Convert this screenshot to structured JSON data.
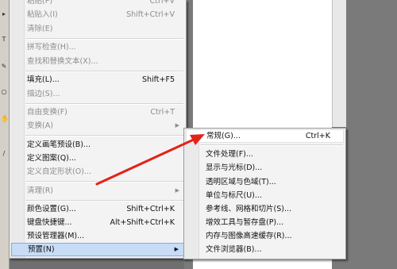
{
  "edit_menu": {
    "items": [
      {
        "label": "粘贴(P)",
        "shortcut": "Ctrl+V",
        "disabled": true
      },
      {
        "label": "粘贴入(I)",
        "shortcut": "Shift+Ctrl+V",
        "disabled": true
      },
      {
        "label": "清除(E)",
        "shortcut": "",
        "disabled": true
      },
      {
        "label": "拼写检查(H)...",
        "shortcut": "",
        "disabled": true
      },
      {
        "label": "查找和替换文本(X)...",
        "shortcut": "",
        "disabled": true
      },
      {
        "label": "填充(L)...",
        "shortcut": "Shift+F5",
        "disabled": false
      },
      {
        "label": "描边(S)...",
        "shortcut": "",
        "disabled": true
      },
      {
        "label": "自由变换(F)",
        "shortcut": "Ctrl+T",
        "disabled": true
      },
      {
        "label": "变换(A)",
        "shortcut": "",
        "disabled": true
      },
      {
        "label": "定义画笔预设(B)...",
        "shortcut": "",
        "disabled": false
      },
      {
        "label": "定义图案(Q)...",
        "shortcut": "",
        "disabled": false
      },
      {
        "label": "定义自定形状(O)...",
        "shortcut": "",
        "disabled": true
      },
      {
        "label": "清理(R)",
        "shortcut": "",
        "disabled": true
      },
      {
        "label": "颜色设置(G)...",
        "shortcut": "Shift+Ctrl+K",
        "disabled": false
      },
      {
        "label": "键盘快捷键...",
        "shortcut": "Alt+Shift+Ctrl+K",
        "disabled": false
      },
      {
        "label": "预设管理器(M)...",
        "shortcut": "",
        "disabled": false
      },
      {
        "label": "预置(N)",
        "shortcut": "",
        "disabled": false
      }
    ]
  },
  "preferences_submenu": {
    "items": [
      {
        "label": "常规(G)...",
        "shortcut": "Ctrl+K"
      },
      {
        "label": "文件处理(F)...",
        "shortcut": ""
      },
      {
        "label": "显示与光标(D)...",
        "shortcut": ""
      },
      {
        "label": "透明区域与色域(T)...",
        "shortcut": ""
      },
      {
        "label": "单位与标尺(U)...",
        "shortcut": ""
      },
      {
        "label": "参考线、网格和切片(S)...",
        "shortcut": ""
      },
      {
        "label": "增效工具与暂存盘(P)...",
        "shortcut": ""
      },
      {
        "label": "内存与图像高速缓存(R)...",
        "shortcut": ""
      },
      {
        "label": "文件浏览器(B)...",
        "shortcut": ""
      }
    ]
  },
  "colors": {
    "annotation_arrow": "#e2231a",
    "highlight": "#c6dcf7"
  }
}
